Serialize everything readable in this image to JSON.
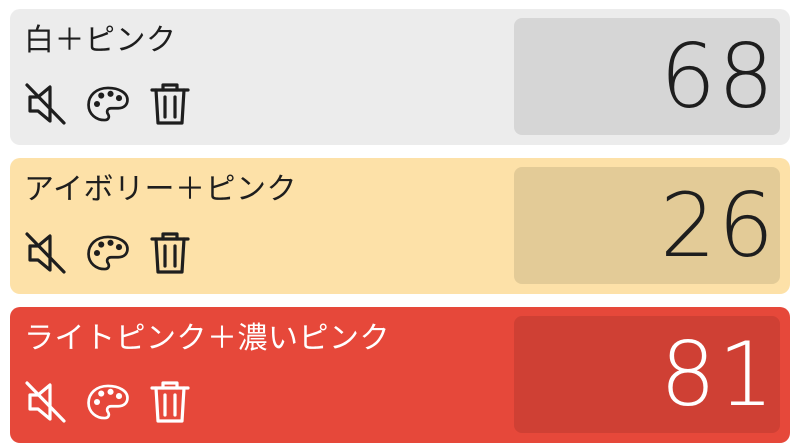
{
  "counters": [
    {
      "name": "白＋ピンク",
      "count": "68",
      "colors": {
        "card": "#ececec",
        "box": "#d6d6d6",
        "text": "#1e1e1e"
      },
      "icons": [
        "mute-icon",
        "palette-icon",
        "trash-icon"
      ]
    },
    {
      "name": "アイボリー＋ピンク",
      "count": "26",
      "colors": {
        "card": "#fde1a8",
        "box": "#e3cb97",
        "text": "#1e1e1e"
      },
      "icons": [
        "mute-icon",
        "palette-icon",
        "trash-icon"
      ]
    },
    {
      "name": "ライトピンク＋濃いピンク",
      "count": "81",
      "colors": {
        "card": "#e6483a",
        "box": "#cf4034",
        "text": "#ffffff"
      },
      "icons": [
        "mute-icon",
        "palette-icon",
        "trash-icon"
      ]
    }
  ]
}
